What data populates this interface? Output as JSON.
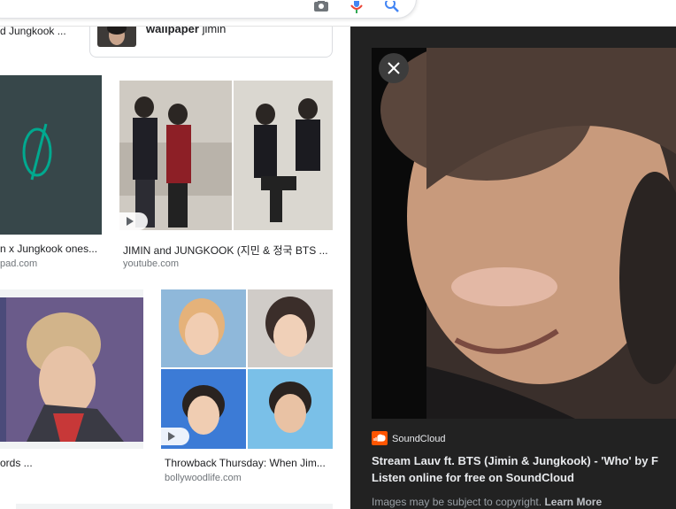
{
  "search": {
    "camera_icon": "camera-icon",
    "mic_icon": "mic-icon",
    "search_icon": "search-icon"
  },
  "related": {
    "left_text": "d Jungkook ...",
    "chip_bold": "wallpaper",
    "chip_text": "jimin"
  },
  "results": [
    {
      "caption": "n x Jungkook ones...",
      "source": "pad.com"
    },
    {
      "caption": "JIMIN and JUNGKOOK (지민 & 정국 BTS ...",
      "source": "youtube.com"
    },
    {
      "caption": "ords ...",
      "source": ""
    },
    {
      "caption": "Throwback Thursday: When Jim...",
      "source": "bollywoodlife.com"
    }
  ],
  "preview": {
    "source_name": "SoundCloud",
    "title": "Stream Lauv ft. BTS (Jimin & Jungkook) - 'Who' by F\nListen online for free on SoundCloud",
    "copyright_text": "Images may be subject to copyright.",
    "learn_more": "Learn More"
  },
  "colors": {
    "accent_blue": "#4285f4",
    "soundcloud": "#ff5500",
    "teal_logo": "#00a98f"
  }
}
